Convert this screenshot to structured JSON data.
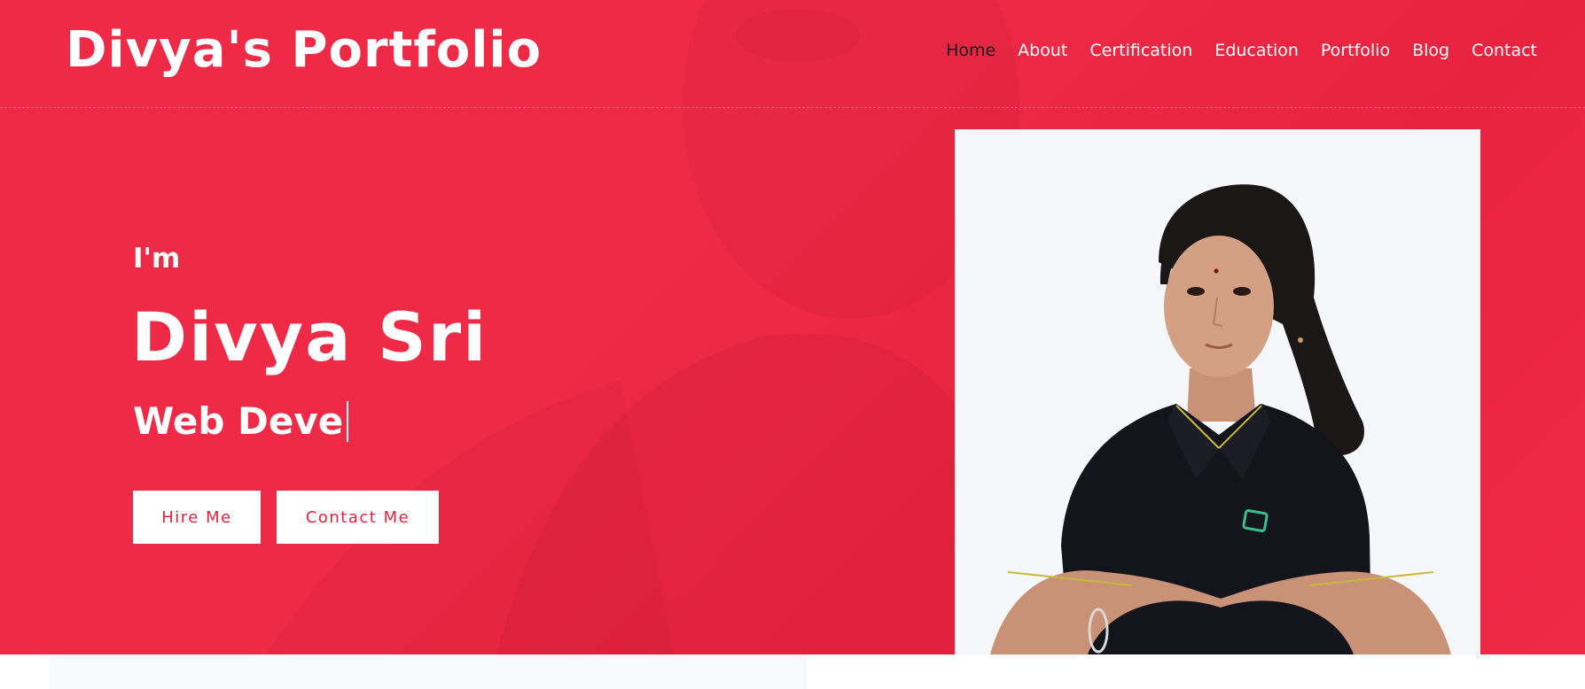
{
  "header": {
    "logo": "Divya's Portfolio",
    "nav": [
      {
        "label": "Home",
        "active": true
      },
      {
        "label": "About"
      },
      {
        "label": "Certification"
      },
      {
        "label": "Education"
      },
      {
        "label": "Portfolio"
      },
      {
        "label": "Blog"
      },
      {
        "label": "Contact"
      }
    ]
  },
  "hero": {
    "greeting": "I'm",
    "name": "Divya Sri",
    "role_typed": "Web Deve",
    "buttons": {
      "hire": "Hire Me",
      "contact": "Contact Me"
    },
    "photo_alt": "portrait photo",
    "accent_color": "#ef2a47"
  },
  "icons": {
    "caret": "text-caret-icon"
  }
}
